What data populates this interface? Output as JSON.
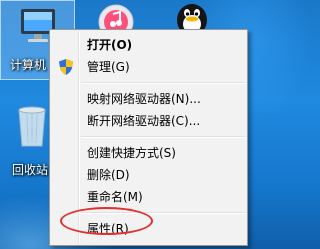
{
  "desktop": {
    "icons": [
      {
        "label": "计算机",
        "icon": "computer-icon"
      },
      {
        "label": "回收站",
        "icon": "recycle-bin-icon"
      },
      {
        "label": "",
        "icon": "itunes-icon"
      },
      {
        "label": "",
        "icon": "qq-penguin-icon"
      }
    ]
  },
  "context_menu": {
    "items": [
      {
        "label": "打开(O)",
        "bold": true
      },
      {
        "label": "管理(G)",
        "icon": "uac-shield-icon"
      },
      {
        "label": "映射网络驱动器(N)..."
      },
      {
        "label": "断开网络驱动器(C)..."
      },
      {
        "label": "创建快捷方式(S)"
      },
      {
        "label": "删除(D)"
      },
      {
        "label": "重命名(M)"
      },
      {
        "label": "属性(R)",
        "highlighted": true
      }
    ]
  },
  "colors": {
    "desktop_blue": "#1f8ae0",
    "menu_background": "#f2f2f2",
    "highlight_ring": "#e03030"
  }
}
